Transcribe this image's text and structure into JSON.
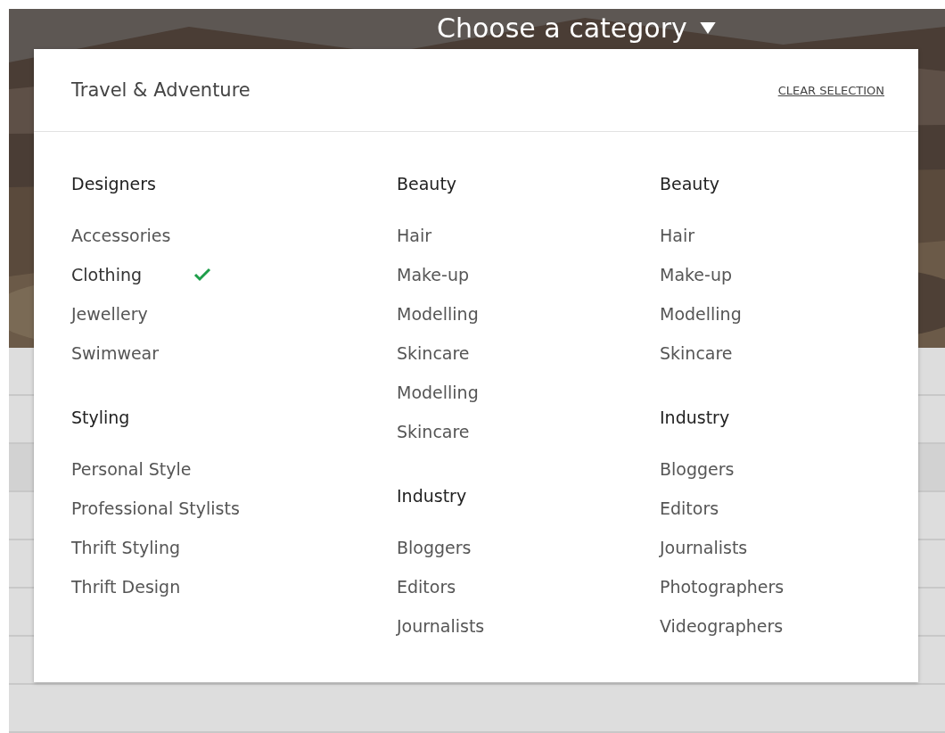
{
  "hero": {
    "title": "Choose a category"
  },
  "panel": {
    "title": "Travel & Adventure",
    "clear_button": "CLEAR SELECTION",
    "columns": [
      {
        "groups": [
          {
            "heading": "Designers",
            "items": [
              {
                "label": "Accessories",
                "selected": false
              },
              {
                "label": "Clothing",
                "selected": true
              },
              {
                "label": "Jewellery",
                "selected": false
              },
              {
                "label": "Swimwear",
                "selected": false
              }
            ]
          },
          {
            "heading": "Styling",
            "items": [
              {
                "label": "Personal Style",
                "selected": false
              },
              {
                "label": "Professional Stylists",
                "selected": false
              },
              {
                "label": "Thrift Styling",
                "selected": false
              },
              {
                "label": "Thrift Design",
                "selected": false
              }
            ]
          }
        ]
      },
      {
        "groups": [
          {
            "heading": "Beauty",
            "items": [
              {
                "label": "Hair",
                "selected": false
              },
              {
                "label": "Make-up",
                "selected": false
              },
              {
                "label": "Modelling",
                "selected": false
              },
              {
                "label": "Skincare",
                "selected": false
              },
              {
                "label": "Modelling",
                "selected": false
              },
              {
                "label": "Skincare",
                "selected": false
              }
            ]
          },
          {
            "heading": "Industry",
            "items": [
              {
                "label": "Bloggers",
                "selected": false
              },
              {
                "label": "Editors",
                "selected": false
              },
              {
                "label": "Journalists",
                "selected": false
              }
            ]
          }
        ]
      },
      {
        "groups": [
          {
            "heading": "Beauty",
            "items": [
              {
                "label": "Hair",
                "selected": false
              },
              {
                "label": "Make-up",
                "selected": false
              },
              {
                "label": "Modelling",
                "selected": false
              },
              {
                "label": "Skincare",
                "selected": false
              }
            ]
          },
          {
            "heading": "Industry",
            "items": [
              {
                "label": "Bloggers",
                "selected": false
              },
              {
                "label": "Editors",
                "selected": false
              },
              {
                "label": "Journalists",
                "selected": false
              },
              {
                "label": "Photographers",
                "selected": false
              },
              {
                "label": "Videographers",
                "selected": false
              }
            ]
          }
        ]
      }
    ]
  }
}
